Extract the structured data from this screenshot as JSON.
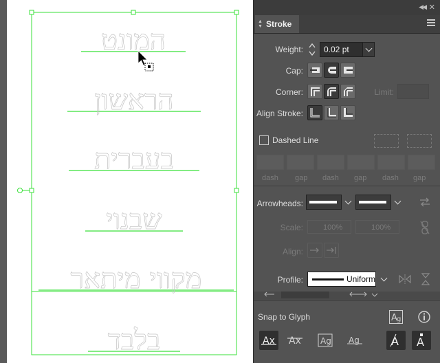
{
  "canvas": {
    "hebrew_lines": [
      "המונט",
      "הראשון",
      "בעברית",
      "שבנוי",
      "מקווי מיתאר",
      "בלבד"
    ]
  },
  "panel": {
    "tab_label": "Stroke",
    "weight": {
      "label": "Weight:",
      "value": "0.02 pt"
    },
    "cap": {
      "label": "Cap:",
      "selected": "round-cap"
    },
    "corner": {
      "label": "Corner:",
      "selected": "round-join",
      "limit_label": "Limit:"
    },
    "align_stroke": {
      "label": "Align Stroke:",
      "selected": "center"
    },
    "dashed_line": {
      "label": "Dashed Line",
      "checked": false
    },
    "dash_gap_labels": [
      "dash",
      "gap",
      "dash",
      "gap",
      "dash",
      "gap"
    ],
    "arrowheads": {
      "label": "Arrowheads:"
    },
    "scale": {
      "label": "Scale:",
      "start": "100%",
      "end": "100%"
    },
    "align": {
      "label": "Align:"
    },
    "profile": {
      "label": "Profile:",
      "value": "Uniform"
    },
    "snap_to_glyph": {
      "label": "Snap to Glyph"
    }
  },
  "colors": {
    "selection": "#39e039",
    "panel_bg": "#535353",
    "panel_dark": "#3c3c3c"
  }
}
